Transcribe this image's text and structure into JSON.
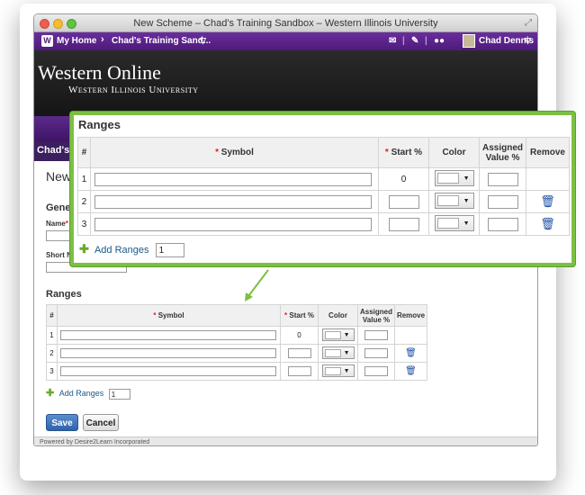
{
  "window": {
    "title": "New Scheme – Chad's Training Sandbox – Western Illinois University"
  },
  "navbar": {
    "logo": "W",
    "home": "My Home",
    "course": "Chad's Training Sand...",
    "user": "Chad Dennis"
  },
  "banner": {
    "title": "Western Online",
    "subtitle": "Western Illinois University"
  },
  "page": {
    "course_title_partial": "Chad's T",
    "heading_partial": "New",
    "section_general": "Gener",
    "label_name": "Name",
    "label_short_name": "Short N",
    "footer": "Powered by Desire2Learn Incorporated"
  },
  "ranges": {
    "title": "Ranges",
    "columns": {
      "num": "#",
      "symbol": "Symbol",
      "start": "Start %",
      "color": "Color",
      "assigned_line1": "Assigned",
      "assigned_line2": "Value %",
      "remove": "Remove"
    },
    "required_mark": "*",
    "rows": [
      {
        "num": "1",
        "start": "0"
      },
      {
        "num": "2",
        "start": ""
      },
      {
        "num": "3",
        "start": ""
      }
    ],
    "add_label": "Add Ranges",
    "add_count": "1"
  },
  "buttons": {
    "save": "Save",
    "cancel": "Cancel"
  },
  "colors": {
    "purple": "#4e1a7a",
    "green_highlight": "#7cc043",
    "link": "#1a5a8a",
    "save_blue": "#3a6fb0"
  }
}
